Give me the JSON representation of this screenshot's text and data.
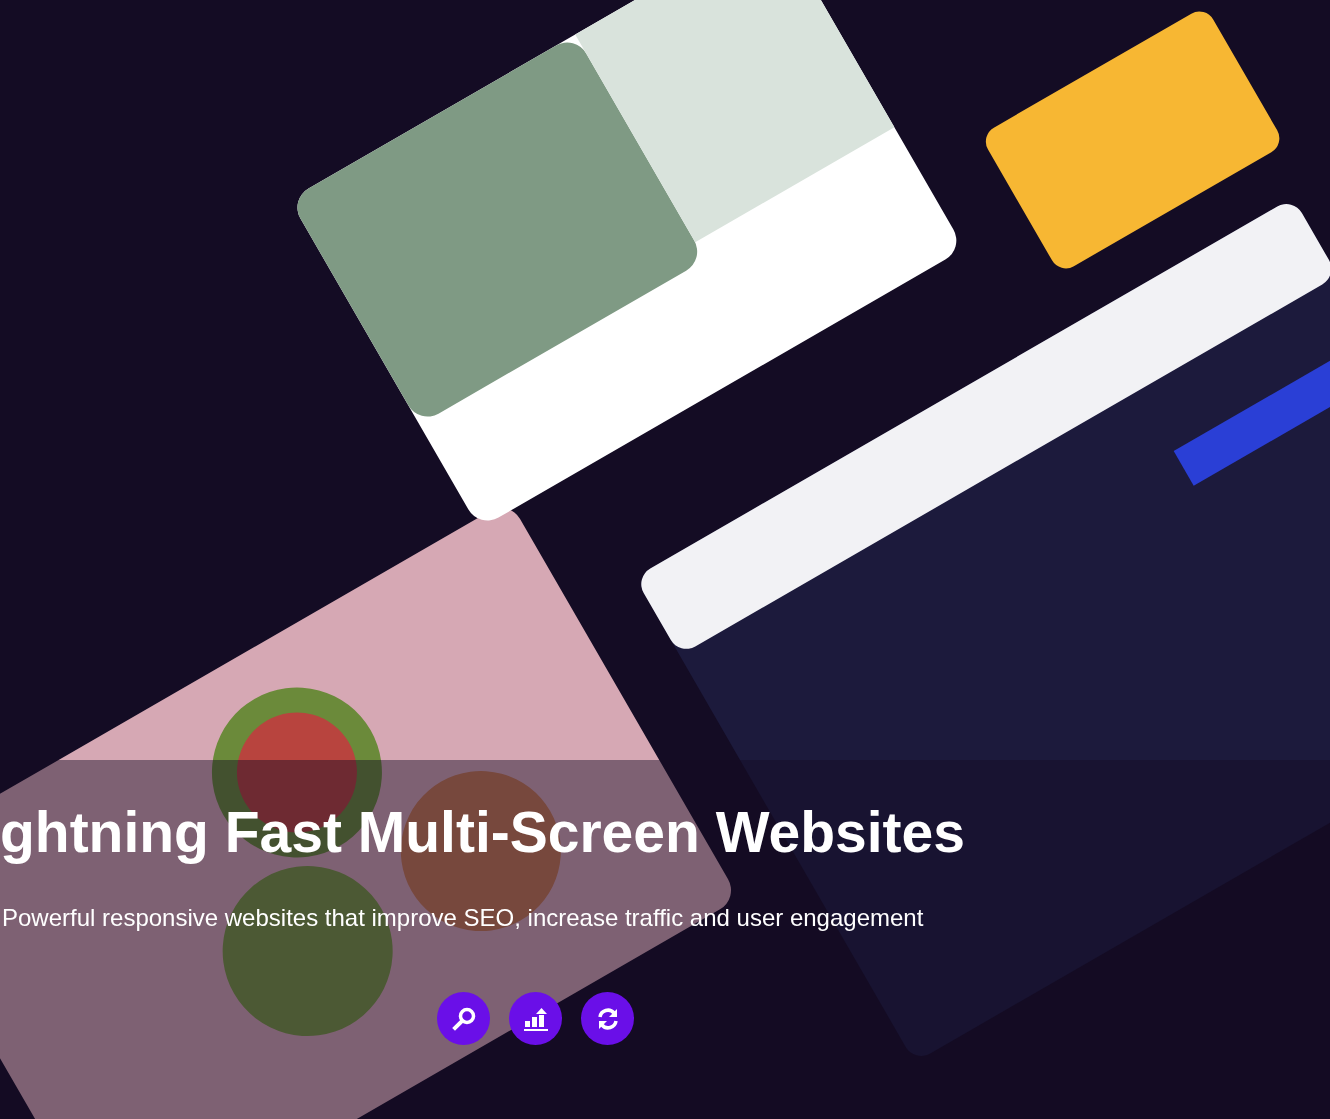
{
  "hero": {
    "title": "ghtning Fast Multi-Screen Websites",
    "subtitle": "Powerful responsive websites that improve SEO, increase traffic and user engagement",
    "buttons": [
      {
        "kind": "search"
      },
      {
        "kind": "chart"
      },
      {
        "kind": "refresh"
      }
    ]
  }
}
